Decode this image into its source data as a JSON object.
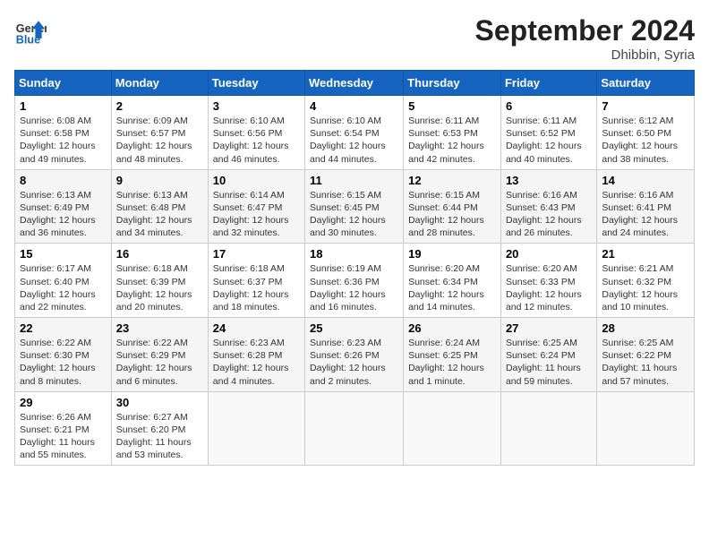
{
  "logo": {
    "line1": "General",
    "line2": "Blue"
  },
  "title": "September 2024",
  "location": "Dhibbin, Syria",
  "days_of_week": [
    "Sunday",
    "Monday",
    "Tuesday",
    "Wednesday",
    "Thursday",
    "Friday",
    "Saturday"
  ],
  "weeks": [
    [
      {
        "day": 1,
        "sunrise": "6:08 AM",
        "sunset": "6:58 PM",
        "daylight": "12 hours and 49 minutes."
      },
      {
        "day": 2,
        "sunrise": "6:09 AM",
        "sunset": "6:57 PM",
        "daylight": "12 hours and 48 minutes."
      },
      {
        "day": 3,
        "sunrise": "6:10 AM",
        "sunset": "6:56 PM",
        "daylight": "12 hours and 46 minutes."
      },
      {
        "day": 4,
        "sunrise": "6:10 AM",
        "sunset": "6:54 PM",
        "daylight": "12 hours and 44 minutes."
      },
      {
        "day": 5,
        "sunrise": "6:11 AM",
        "sunset": "6:53 PM",
        "daylight": "12 hours and 42 minutes."
      },
      {
        "day": 6,
        "sunrise": "6:11 AM",
        "sunset": "6:52 PM",
        "daylight": "12 hours and 40 minutes."
      },
      {
        "day": 7,
        "sunrise": "6:12 AM",
        "sunset": "6:50 PM",
        "daylight": "12 hours and 38 minutes."
      }
    ],
    [
      {
        "day": 8,
        "sunrise": "6:13 AM",
        "sunset": "6:49 PM",
        "daylight": "12 hours and 36 minutes."
      },
      {
        "day": 9,
        "sunrise": "6:13 AM",
        "sunset": "6:48 PM",
        "daylight": "12 hours and 34 minutes."
      },
      {
        "day": 10,
        "sunrise": "6:14 AM",
        "sunset": "6:47 PM",
        "daylight": "12 hours and 32 minutes."
      },
      {
        "day": 11,
        "sunrise": "6:15 AM",
        "sunset": "6:45 PM",
        "daylight": "12 hours and 30 minutes."
      },
      {
        "day": 12,
        "sunrise": "6:15 AM",
        "sunset": "6:44 PM",
        "daylight": "12 hours and 28 minutes."
      },
      {
        "day": 13,
        "sunrise": "6:16 AM",
        "sunset": "6:43 PM",
        "daylight": "12 hours and 26 minutes."
      },
      {
        "day": 14,
        "sunrise": "6:16 AM",
        "sunset": "6:41 PM",
        "daylight": "12 hours and 24 minutes."
      }
    ],
    [
      {
        "day": 15,
        "sunrise": "6:17 AM",
        "sunset": "6:40 PM",
        "daylight": "12 hours and 22 minutes."
      },
      {
        "day": 16,
        "sunrise": "6:18 AM",
        "sunset": "6:39 PM",
        "daylight": "12 hours and 20 minutes."
      },
      {
        "day": 17,
        "sunrise": "6:18 AM",
        "sunset": "6:37 PM",
        "daylight": "12 hours and 18 minutes."
      },
      {
        "day": 18,
        "sunrise": "6:19 AM",
        "sunset": "6:36 PM",
        "daylight": "12 hours and 16 minutes."
      },
      {
        "day": 19,
        "sunrise": "6:20 AM",
        "sunset": "6:34 PM",
        "daylight": "12 hours and 14 minutes."
      },
      {
        "day": 20,
        "sunrise": "6:20 AM",
        "sunset": "6:33 PM",
        "daylight": "12 hours and 12 minutes."
      },
      {
        "day": 21,
        "sunrise": "6:21 AM",
        "sunset": "6:32 PM",
        "daylight": "12 hours and 10 minutes."
      }
    ],
    [
      {
        "day": 22,
        "sunrise": "6:22 AM",
        "sunset": "6:30 PM",
        "daylight": "12 hours and 8 minutes."
      },
      {
        "day": 23,
        "sunrise": "6:22 AM",
        "sunset": "6:29 PM",
        "daylight": "12 hours and 6 minutes."
      },
      {
        "day": 24,
        "sunrise": "6:23 AM",
        "sunset": "6:28 PM",
        "daylight": "12 hours and 4 minutes."
      },
      {
        "day": 25,
        "sunrise": "6:23 AM",
        "sunset": "6:26 PM",
        "daylight": "12 hours and 2 minutes."
      },
      {
        "day": 26,
        "sunrise": "6:24 AM",
        "sunset": "6:25 PM",
        "daylight": "12 hours and 1 minute."
      },
      {
        "day": 27,
        "sunrise": "6:25 AM",
        "sunset": "6:24 PM",
        "daylight": "11 hours and 59 minutes."
      },
      {
        "day": 28,
        "sunrise": "6:25 AM",
        "sunset": "6:22 PM",
        "daylight": "11 hours and 57 minutes."
      }
    ],
    [
      {
        "day": 29,
        "sunrise": "6:26 AM",
        "sunset": "6:21 PM",
        "daylight": "11 hours and 55 minutes."
      },
      {
        "day": 30,
        "sunrise": "6:27 AM",
        "sunset": "6:20 PM",
        "daylight": "11 hours and 53 minutes."
      },
      null,
      null,
      null,
      null,
      null
    ]
  ]
}
